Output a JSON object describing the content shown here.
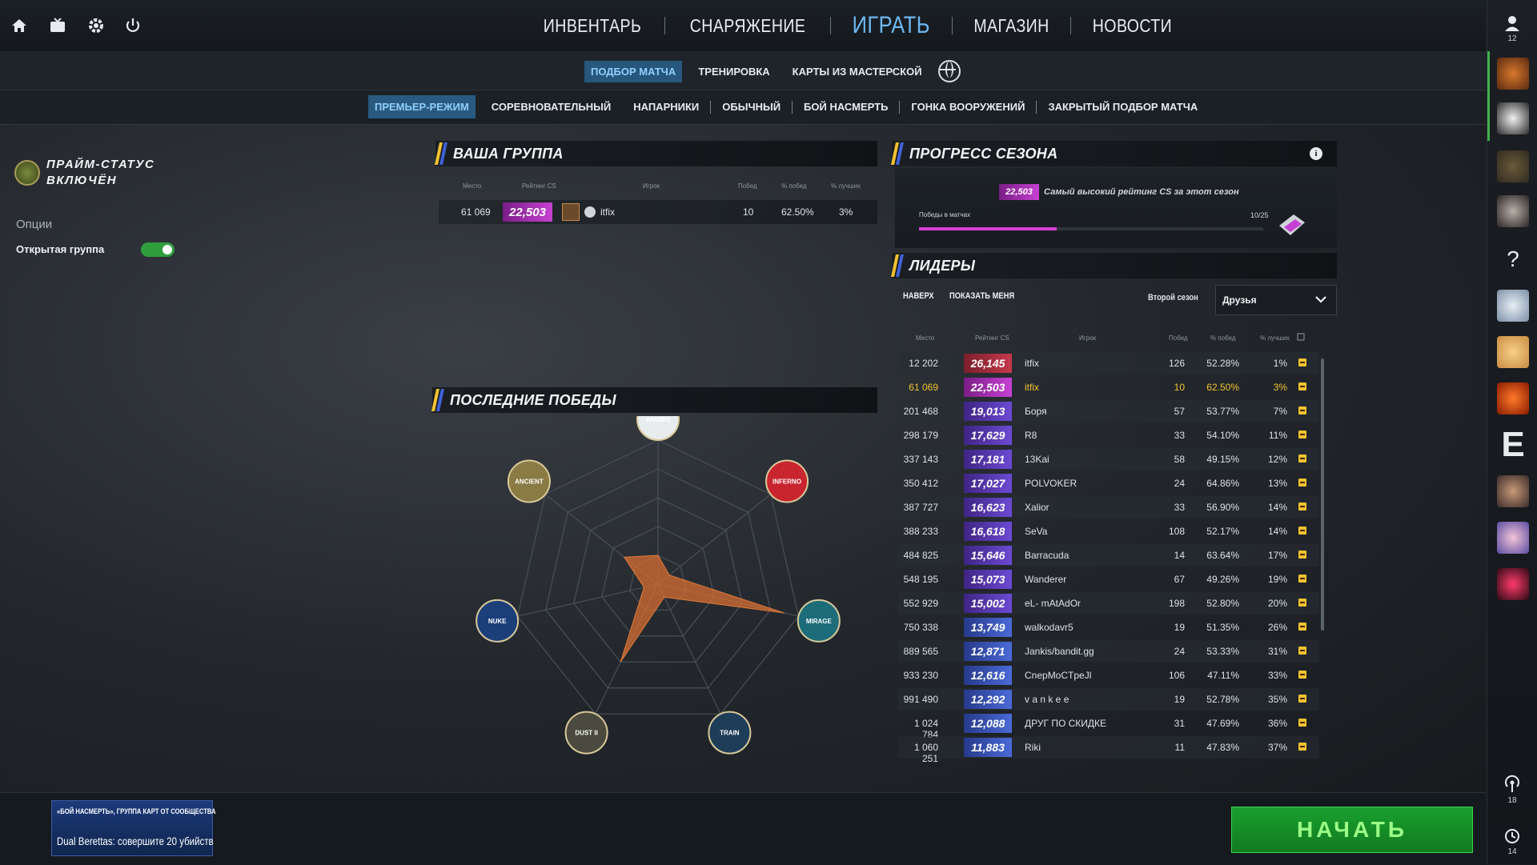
{
  "topnav": {
    "items": [
      "ИНВЕНТАРЬ",
      "СНАРЯЖЕНИЕ",
      "ИГРАТЬ",
      "МАГАЗИН",
      "НОВОСТИ"
    ],
    "active_index": 2
  },
  "icons": {
    "home": "home-icon",
    "tv": "tv-icon",
    "settings": "gear-icon",
    "power": "power-icon",
    "globe": "globe-icon"
  },
  "right_sidebar": {
    "friends_count": "12",
    "help": "?",
    "letter_tile": "E",
    "broadcast_count": "18",
    "history_count": "14"
  },
  "subtabs": [
    "ПОДБОР МАТЧА",
    "ТРЕНИРОВКА",
    "КАРТЫ ИЗ МАСТЕРСКОЙ"
  ],
  "modes": [
    "ПРЕМЬЕР-РЕЖИМ",
    "СОРЕВНОВАТЕЛЬНЫЙ",
    "НАПАРНИКИ",
    "ОБЫЧНЫЙ",
    "БОЙ НАСМЕРТЬ",
    "ГОНКА ВООРУЖЕНИЙ",
    "ЗАКРЫТЫЙ ПОДБОР МАТЧА"
  ],
  "left": {
    "prime_line1": "ПРАЙМ-СТАТУС",
    "prime_line2": "ВКЛЮЧЁН",
    "options": "Опции",
    "open_group": "Открытая группа",
    "open_group_on": true
  },
  "group": {
    "title": "ВАША ГРУППА",
    "headers": [
      "Место",
      "Рейтинг CS",
      "Игрок",
      "Побед",
      "% побед",
      "% лучших"
    ],
    "row": {
      "place": "61 069",
      "rating": "22,503",
      "player": "itfix",
      "wins": "10",
      "winrate": "62.50%",
      "top": "3%"
    }
  },
  "last_wins": {
    "title": "ПОСЛЕДНИЕ ПОБЕДЫ",
    "maps": [
      "ANUBIS",
      "INFERNO",
      "MIRAGE",
      "TRAIN",
      "DUST II",
      "NUKE",
      "ANCIENT"
    ],
    "values": [
      0.2,
      0.1,
      0.9,
      0.1,
      0.6,
      0.1,
      0.3
    ]
  },
  "season": {
    "title": "ПРОГРЕСС СЕЗОНА",
    "best_rating": "22,503",
    "best_label": "Самый высокий рейтинг CS за этот сезон",
    "wins_label": "Победы в матчах",
    "wins_value": "10/25",
    "progress": 0.4
  },
  "leaders": {
    "title": "ЛИДЕРЫ",
    "top_btn": "НАВЕРХ",
    "show_me_btn": "ПОКАЗАТЬ МЕНЯ",
    "season_label": "Второй сезон",
    "filter": "Друзья",
    "headers": [
      "Место",
      "Рейтинг CS",
      "Игрок",
      "Побед",
      "% побед",
      "% лучших"
    ],
    "rows": [
      {
        "place": "12 202",
        "rating": "26,145",
        "player": "itfix",
        "wins": "126",
        "winrate": "52.28%",
        "top": "1%",
        "tier": "red"
      },
      {
        "place": "61 069",
        "rating": "22,503",
        "player": "itfix",
        "wins": "10",
        "winrate": "62.50%",
        "top": "3%",
        "tier": "pink",
        "me": true
      },
      {
        "place": "201 468",
        "rating": "19,013",
        "player": "Боря",
        "wins": "57",
        "winrate": "53.77%",
        "top": "7%",
        "tier": "purple"
      },
      {
        "place": "298 179",
        "rating": "17,629",
        "player": "R8",
        "wins": "33",
        "winrate": "54.10%",
        "top": "11%",
        "tier": "purple"
      },
      {
        "place": "337 143",
        "rating": "17,181",
        "player": "13Kai",
        "wins": "58",
        "winrate": "49.15%",
        "top": "12%",
        "tier": "purple"
      },
      {
        "place": "350 412",
        "rating": "17,027",
        "player": "POLVOKER",
        "wins": "24",
        "winrate": "64.86%",
        "top": "13%",
        "tier": "purple"
      },
      {
        "place": "387 727",
        "rating": "16,623",
        "player": "Xalior",
        "wins": "33",
        "winrate": "56.90%",
        "top": "14%",
        "tier": "purple"
      },
      {
        "place": "388 233",
        "rating": "16,618",
        "player": "SeVa",
        "wins": "108",
        "winrate": "52.17%",
        "top": "14%",
        "tier": "purple"
      },
      {
        "place": "484 825",
        "rating": "15,646",
        "player": "Barracuda",
        "wins": "14",
        "winrate": "63.64%",
        "top": "17%",
        "tier": "purple"
      },
      {
        "place": "548 195",
        "rating": "15,073",
        "player": "Wanderer",
        "wins": "67",
        "winrate": "49.26%",
        "top": "19%",
        "tier": "purple"
      },
      {
        "place": "552 929",
        "rating": "15,002",
        "player": "eL- mAtAdOr",
        "wins": "198",
        "winrate": "52.80%",
        "top": "20%",
        "tier": "purple"
      },
      {
        "place": "750 338",
        "rating": "13,749",
        "player": "walkodavr5",
        "wins": "19",
        "winrate": "51.35%",
        "top": "26%",
        "tier": "blue"
      },
      {
        "place": "889 565",
        "rating": "12,871",
        "player": "Jankis/bandit.gg",
        "wins": "24",
        "winrate": "53.33%",
        "top": "31%",
        "tier": "blue"
      },
      {
        "place": "933 230",
        "rating": "12,616",
        "player": "CnepMoCTpeJl",
        "wins": "106",
        "winrate": "47.11%",
        "top": "33%",
        "tier": "blue"
      },
      {
        "place": "991 490",
        "rating": "12,292",
        "player": "v a n k e e",
        "wins": "19",
        "winrate": "52.78%",
        "top": "35%",
        "tier": "blue"
      },
      {
        "place": "1 024 784",
        "rating": "12,088",
        "player": "ДРУГ ПО СКИДКЕ",
        "wins": "31",
        "winrate": "47.69%",
        "top": "36%",
        "tier": "blue"
      },
      {
        "place": "1 060 251",
        "rating": "11,883",
        "player": "Riki",
        "wins": "11",
        "winrate": "47.83%",
        "top": "37%",
        "tier": "blue"
      }
    ]
  },
  "promo": {
    "line1": "«БОЙ НАСМЕРТЬ», ГРУППА КАРТ ОТ СООБЩЕСТВА",
    "line2": "Dual Berettas: совершите 20 убийств"
  },
  "start_label": "НАЧАТЬ"
}
